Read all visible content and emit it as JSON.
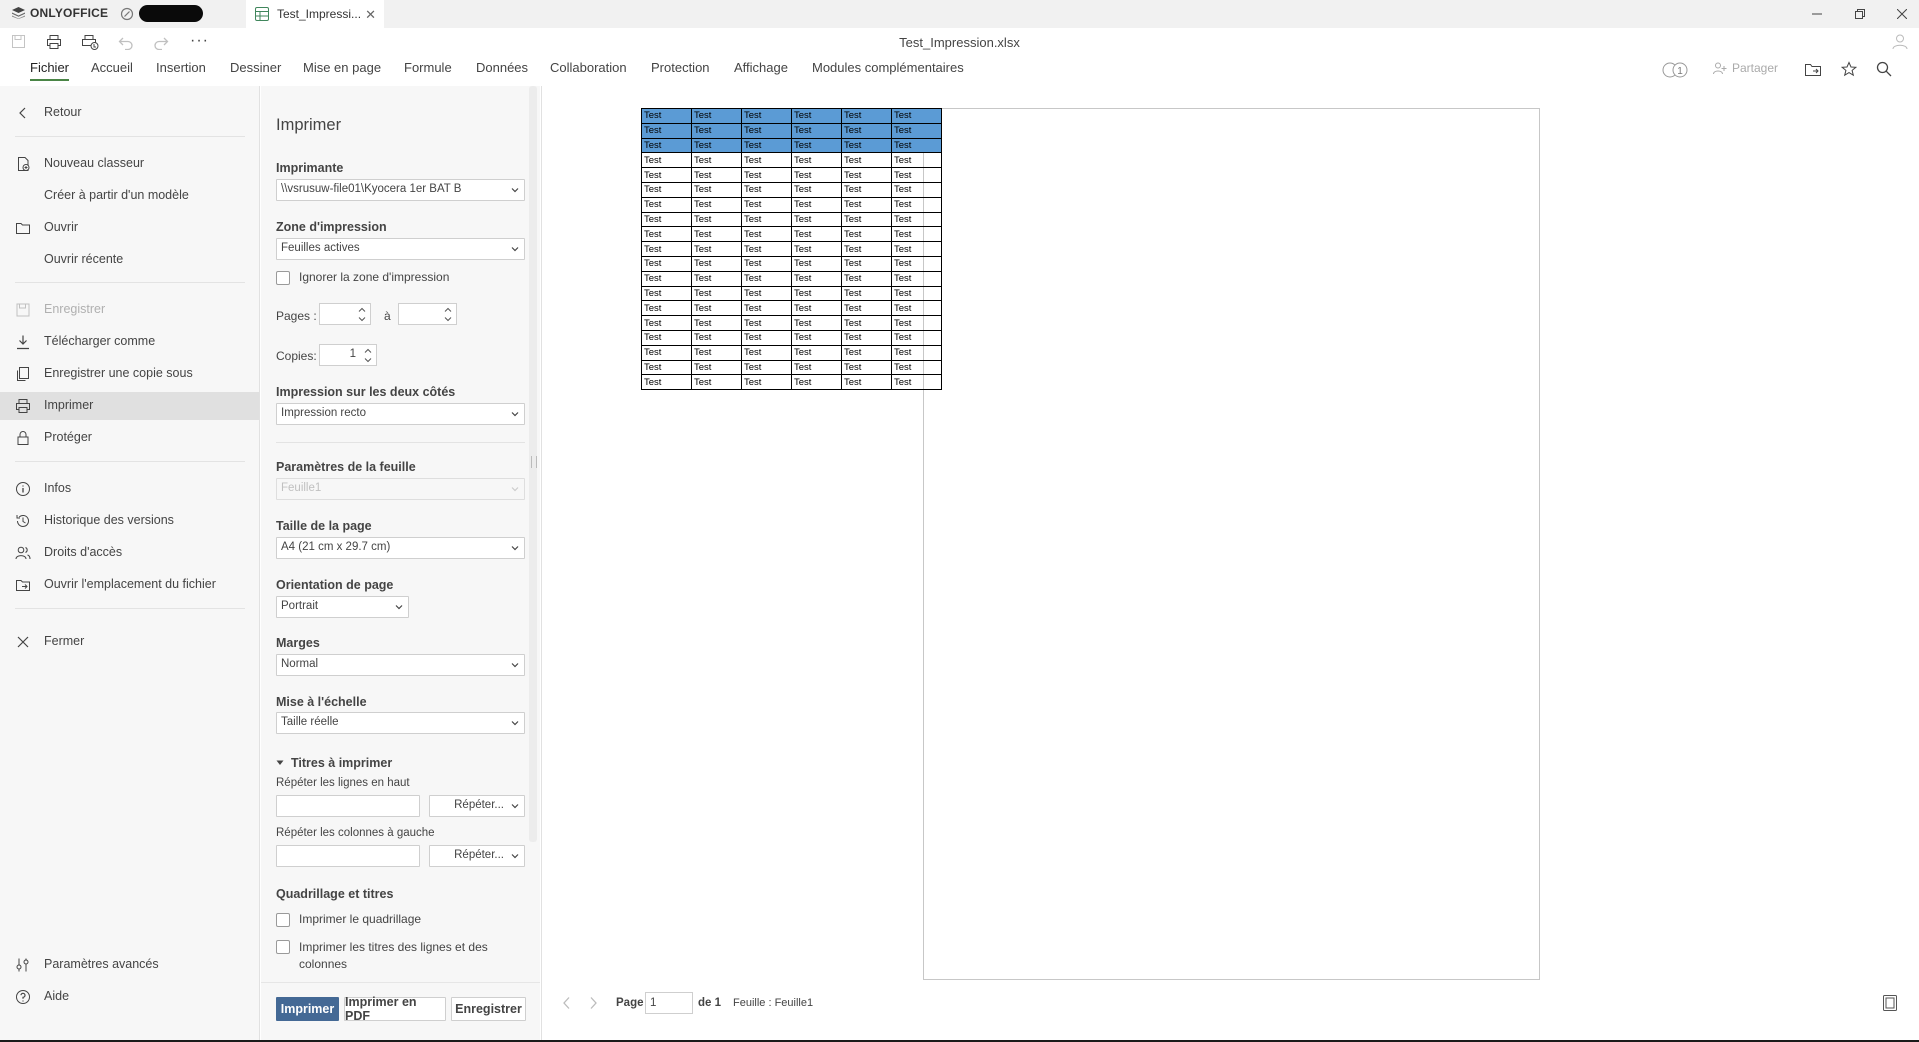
{
  "app": {
    "brand": "ONLYOFFICE",
    "doc_tab_title": "Test_Impressi...",
    "doc_title": "Test_Impression.xlsx"
  },
  "menu_tabs": [
    "Fichier",
    "Accueil",
    "Insertion",
    "Dessiner",
    "Mise en page",
    "Formule",
    "Données",
    "Collaboration",
    "Protection",
    "Affichage",
    "Modules complémentaires"
  ],
  "top_right": {
    "share": "Partager",
    "users_count": "1"
  },
  "file_menu": {
    "back": "Retour",
    "new_workbook": "Nouveau classeur",
    "from_template": "Créer à partir d'un modèle",
    "open": "Ouvrir",
    "open_recent": "Ouvrir récente",
    "save": "Enregistrer",
    "download_as": "Télécharger comme",
    "save_copy_as": "Enregistrer une copie sous",
    "print": "Imprimer",
    "protect": "Protéger",
    "info": "Infos",
    "version_history": "Historique des versions",
    "access_rights": "Droits d'accès",
    "open_location": "Ouvrir l'emplacement du fichier",
    "close": "Fermer",
    "advanced_settings": "Paramètres avancés",
    "help": "Aide"
  },
  "print_panel": {
    "title": "Imprimer",
    "printer_label": "Imprimante",
    "printer_value": "\\\\vsrusuw-file01\\Kyocera 1er BAT B",
    "print_area_label": "Zone d'impression",
    "print_area_value": "Feuilles actives",
    "ignore_area": "Ignorer la zone d'impression",
    "pages_label": "Pages :",
    "pages_to": "à",
    "copies_label": "Copies:",
    "copies_value": "1",
    "duplex_label": "Impression sur les deux côtés",
    "duplex_value": "Impression recto",
    "sheet_params_label": "Paramètres de la feuille",
    "sheet_value": "Feuille1",
    "page_size_label": "Taille de la page",
    "page_size_value": "A4 (21 cm x 29.7 cm)",
    "orientation_label": "Orientation de page",
    "orientation_value": "Portrait",
    "margins_label": "Marges",
    "margins_value": "Normal",
    "scale_label": "Mise à l'échelle",
    "scale_value": "Taille réelle",
    "titles_label": "Titres à imprimer",
    "repeat_rows_label": "Répéter les lignes en haut",
    "repeat_cols_label": "Répéter les colonnes à gauche",
    "repeat_btn": "Répéter...",
    "grid_label": "Quadrillage et titres",
    "print_grid": "Imprimer le quadrillage",
    "print_headings_1": "Imprimer les titres des lignes et des",
    "print_headings_2": "colonnes",
    "btn_print": "Imprimer",
    "btn_pdf": "Imprimer en PDF",
    "btn_save": "Enregistrer"
  },
  "preview": {
    "page_label": "Page",
    "page_value": "1",
    "of_label": "de 1",
    "sheet_info": "Feuille : Feuille1",
    "table": {
      "cell_text": "Test",
      "rows": 19,
      "cols": 6,
      "highlighted_rows": 3,
      "highlight_color": "#5b9bd5"
    }
  },
  "colors": {
    "accent_green": "#4a8546",
    "print_button": "#446995"
  }
}
